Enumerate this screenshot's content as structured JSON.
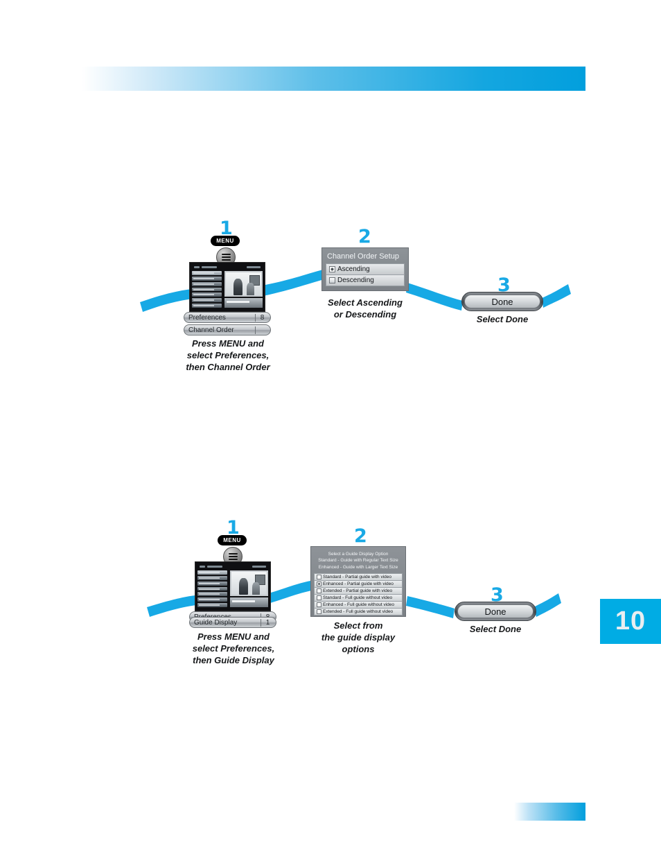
{
  "page": {
    "number": "10",
    "accent_color": "#00ace4",
    "step_number_color": "#19a9e5"
  },
  "section_channel_order": {
    "step1": {
      "number": "1",
      "menu_button_label": "MENU",
      "menu_bars": [
        {
          "label": "Preferences",
          "value": "8"
        },
        {
          "label": "Channel Order",
          "value": ""
        }
      ],
      "caption": "Press MENU and\nselect Preferences,\nthen Channel Order"
    },
    "step2": {
      "number": "2",
      "dialog_title": "Channel Order Setup",
      "options": [
        {
          "label": "Ascending",
          "selected": true
        },
        {
          "label": "Descending",
          "selected": false
        }
      ],
      "caption": "Select Ascending\nor Descending"
    },
    "step3": {
      "number": "3",
      "button_label": "Done",
      "caption": "Select Done"
    }
  },
  "section_guide_display": {
    "step1": {
      "number": "1",
      "menu_button_label": "MENU",
      "menu_bars": [
        {
          "label": "Preferences",
          "value": "8"
        },
        {
          "label": "Guide Display",
          "value": "1"
        }
      ],
      "caption": "Press MENU and\nselect Preferences,\nthen Guide Display"
    },
    "step2": {
      "number": "2",
      "dialog_header": "Select a Guide Display Option\nStandard - Guide with Regular Text Size\nEnhanced - Guide with Larger Text Size",
      "options": [
        {
          "label": "Standard - Partial guide with video",
          "selected": false
        },
        {
          "label": "Enhanced - Partial guide with video",
          "selected": true
        },
        {
          "label": "Extended - Partial guide with video",
          "selected": false
        },
        {
          "label": "Standard - Full guide without video",
          "selected": false
        },
        {
          "label": "Enhanced - Full guide without video",
          "selected": false
        },
        {
          "label": "Extended - Full guide without video",
          "selected": false
        }
      ],
      "caption": "Select from\nthe guide display\noptions"
    },
    "step3": {
      "number": "3",
      "button_label": "Done",
      "caption": "Select Done"
    }
  }
}
